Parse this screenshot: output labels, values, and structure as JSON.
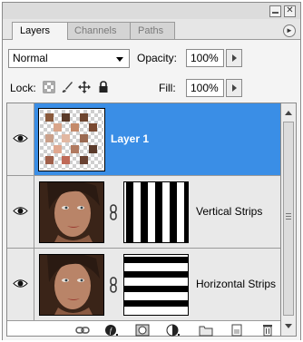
{
  "window": {
    "minimize_icon": "minimize-icon",
    "close_icon": "close-icon",
    "close_glyph": "✕"
  },
  "tabs": [
    {
      "label": "Layers",
      "active": true
    },
    {
      "label": "Channels",
      "active": false
    },
    {
      "label": "Paths",
      "active": false
    }
  ],
  "panel_menu_glyph": "►",
  "blend_mode": {
    "value": "Normal"
  },
  "opacity": {
    "label": "Opacity:",
    "value": "100%"
  },
  "lock": {
    "label": "Lock:",
    "icons": [
      "lock-transparent-pixels-icon",
      "lock-image-pixels-icon",
      "lock-position-icon",
      "lock-all-icon"
    ]
  },
  "fill": {
    "label": "Fill:",
    "value": "100%"
  },
  "layers": [
    {
      "name": "Layer 1",
      "selected": true,
      "visible": true,
      "has_mask": false
    },
    {
      "name": "Vertical Strips",
      "selected": false,
      "visible": true,
      "has_mask": true
    },
    {
      "name": "Horizontal Strips",
      "selected": false,
      "visible": true,
      "has_mask": true
    }
  ],
  "bottom_toolbar": [
    "link-layers-icon",
    "layer-style-icon",
    "add-mask-icon",
    "adjustment-layer-icon",
    "new-group-icon",
    "new-layer-icon",
    "delete-layer-icon"
  ],
  "colors": {
    "selection": "#3a8ee6",
    "panel_bg": "#f4f4f4"
  }
}
